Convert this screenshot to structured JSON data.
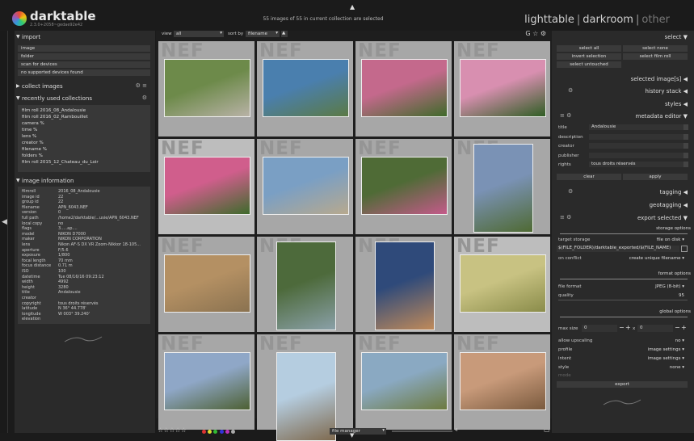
{
  "app": {
    "name": "darktable",
    "version": "2.3.0+2058~gedae92e42"
  },
  "status": {
    "selection_text": "55 images of 55 in current collection are selected"
  },
  "views": {
    "lighttable": "lighttable",
    "darkroom": "darkroom",
    "other": "other",
    "separator": "|"
  },
  "left": {
    "import": {
      "title": "import",
      "items": [
        "image",
        "folder",
        "scan for devices",
        "no supported devices found"
      ]
    },
    "collect": {
      "title": "collect images"
    },
    "recent": {
      "title": "recently used collections",
      "items": [
        "film roll 2016_08_Andalousie",
        "film roll 2016_02_Rambouillet",
        "camera %",
        "time %",
        "lens %",
        "creator %",
        "filename %",
        "folders %",
        "film roll 2015_12_Chateau_du_Loir"
      ]
    },
    "info": {
      "title": "image information",
      "rows": [
        {
          "k": "filmroll",
          "v": "2016_08_Andalousie"
        },
        {
          "k": "image id",
          "v": "22"
        },
        {
          "k": "group id",
          "v": "22"
        },
        {
          "k": "filename",
          "v": "APN_6043.NEF"
        },
        {
          "k": "version",
          "v": "0"
        },
        {
          "k": "full path",
          "v": "/home2/darktable/...usie/APN_6043.NEF"
        },
        {
          "k": "local copy",
          "v": "no"
        },
        {
          "k": "flags",
          "v": "3.....ap...."
        },
        {
          "k": "model",
          "v": "NIKON D7000"
        },
        {
          "k": "maker",
          "v": "NIKON CORPORATION"
        },
        {
          "k": "lens",
          "v": "Nikon AF-S DX VR Zoom-Nikkor 18-105..."
        },
        {
          "k": "aperture",
          "v": "F/5.6"
        },
        {
          "k": "exposure",
          "v": "1/800"
        },
        {
          "k": "focal length",
          "v": "70 mm"
        },
        {
          "k": "focus distance",
          "v": "0.71 m"
        },
        {
          "k": "ISO",
          "v": "100"
        },
        {
          "k": "datetime",
          "v": "Tue 08/16/16 09:23:12"
        },
        {
          "k": "width",
          "v": "4992"
        },
        {
          "k": "height",
          "v": "3280"
        },
        {
          "k": "title",
          "v": "Andalousie"
        },
        {
          "k": "creator",
          "v": ""
        },
        {
          "k": "copyright",
          "v": "tous droits réservés"
        },
        {
          "k": "latitude",
          "v": "N 36° 44.778'"
        },
        {
          "k": "longitude",
          "v": "W 003° 39.240'"
        },
        {
          "k": "elevation",
          "v": ""
        }
      ]
    }
  },
  "toolbar": {
    "view_label": "view",
    "view_value": "all",
    "sort_label": "sort by",
    "sort_value": "filename",
    "icons": "G ☆ ⚙"
  },
  "grid": {
    "watermark": "NEF",
    "thumbs": [
      {
        "c1": "#6d8a4a",
        "c2": "#b8b2a6"
      },
      {
        "c1": "#4a7fae",
        "c2": "#5b7a45"
      },
      {
        "c1": "#c4698c",
        "c2": "#3f6a2a"
      },
      {
        "c1": "#d88fb0",
        "c2": "#2f5e24"
      },
      {
        "c1": "#d05e8c",
        "c2": "#3e6b2c"
      },
      {
        "c1": "#7a9fc4",
        "c2": "#b7a98e"
      },
      {
        "c1": "#4f6b36",
        "c2": "#c45a8a"
      },
      {
        "c1": "#7a92b5",
        "c2": "#4f6a33"
      },
      {
        "c1": "#b49063",
        "c2": "#8a7250"
      },
      {
        "c1": "#4d6a3b",
        "c2": "#8aa0a8"
      },
      {
        "c1": "#2f4a7a",
        "c2": "#c08a5a"
      },
      {
        "c1": "#c8c282",
        "c2": "#8a8c4a"
      },
      {
        "c1": "#8fa7c7",
        "c2": "#4d6033"
      },
      {
        "c1": "#b5cde0",
        "c2": "#7f6a4f"
      },
      {
        "c1": "#8aa9c2",
        "c2": "#6d7a3f"
      },
      {
        "c1": "#c89a7a",
        "c2": "#7a5a3e"
      }
    ]
  },
  "bottom": {
    "stars": "☆☆☆☆☆",
    "layout": "file manager",
    "zoom": "4"
  },
  "right": {
    "select": {
      "title": "select",
      "buttons": [
        "select all",
        "select none",
        "invert selection",
        "select film roll",
        "select untouched"
      ]
    },
    "modules": [
      "selected image[s]",
      "history stack",
      "styles"
    ],
    "metadata": {
      "title": "metadata editor",
      "fields": [
        {
          "k": "title",
          "v": "Andalousie"
        },
        {
          "k": "description",
          "v": ""
        },
        {
          "k": "creator",
          "v": ""
        },
        {
          "k": "publisher",
          "v": ""
        },
        {
          "k": "rights",
          "v": "tous droits réservés"
        }
      ],
      "clear": "clear",
      "apply": "apply"
    },
    "tagging": "tagging",
    "geotagging": "geotagging",
    "export": {
      "title": "export selected",
      "storage_title": "storage options",
      "target_label": "target storage",
      "target_value": "file on disk",
      "path": "$(FILE_FOLDER)/darktable_exported/$(FILE_NAME)",
      "conflict_label": "on conflict",
      "conflict_value": "create unique filename",
      "format_title": "format options",
      "format_label": "file format",
      "format_value": "JPEG (8-bit)",
      "quality_label": "quality",
      "quality_value": "95",
      "global_title": "global options",
      "maxsize_label": "max size",
      "maxsize_w": "0",
      "maxsize_x": "x",
      "maxsize_h": "0",
      "upscale_label": "allow upscaling",
      "upscale_value": "no",
      "profile_label": "profile",
      "profile_value": "image settings",
      "intent_label": "intent",
      "intent_value": "image settings",
      "style_label": "style",
      "style_value": "none",
      "mode_label": "mode",
      "export_button": "export"
    }
  },
  "colors": {
    "panel": "#2a2a2a",
    "thumb_bg": "#a7a7a7",
    "selected": "#bdbdbd"
  }
}
